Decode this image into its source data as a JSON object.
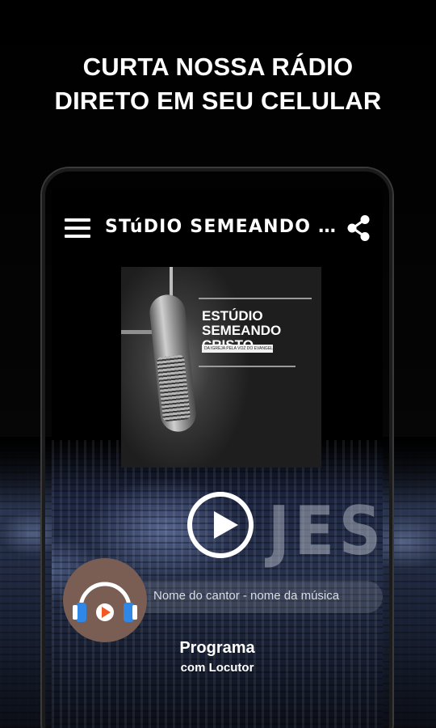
{
  "promo": {
    "headline_line1": "CURTA NOSSA RÁDIO",
    "headline_line2": "DIRETO EM SEU CELULAR"
  },
  "app": {
    "title": "STúDIO SEMEANDO CR...",
    "menu_icon": "menu-icon",
    "share_icon": "share-icon"
  },
  "album": {
    "title": "ESTÚDIO SEMEANDO CRISTO",
    "tag": "DA IGREJA PELA VOZ DO EVANGELHO"
  },
  "background": {
    "banner_text": "JESUS"
  },
  "player": {
    "play_icon": "play-icon",
    "song_line": "Nome do cantor - nome da música",
    "program": "Programa",
    "host": "com Locutor",
    "cover_icon": "headphones-play-icon"
  },
  "colors": {
    "background": "#000000",
    "text": "#ffffff",
    "cover_circle": "#7a5e53",
    "headphone_blue": "#2f87e8",
    "play_orange": "#f15a24"
  }
}
